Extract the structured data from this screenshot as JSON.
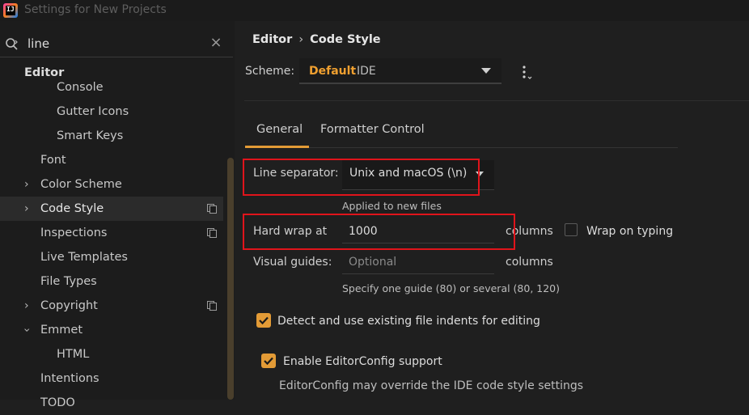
{
  "window": {
    "title": "Settings for New Projects"
  },
  "search": {
    "value": "line"
  },
  "sidebar": {
    "section": "Editor",
    "items": [
      {
        "label": "Console"
      },
      {
        "label": "Gutter Icons"
      },
      {
        "label": "Smart Keys"
      },
      {
        "label": "Font"
      },
      {
        "label": "Color Scheme"
      },
      {
        "label": "Code Style"
      },
      {
        "label": "Inspections"
      },
      {
        "label": "Live Templates"
      },
      {
        "label": "File Types"
      },
      {
        "label": "Copyright"
      },
      {
        "label": "Emmet"
      },
      {
        "label": "HTML"
      },
      {
        "label": "Intentions"
      },
      {
        "label": "TODO"
      }
    ]
  },
  "breadcrumb": {
    "parent": "Editor",
    "separator": "›",
    "current": "Code Style"
  },
  "scheme": {
    "label": "Scheme:",
    "name": "Default",
    "kind": "IDE"
  },
  "tabs": [
    {
      "label": "General"
    },
    {
      "label": "Formatter Control"
    }
  ],
  "general": {
    "line_separator": {
      "label": "Line separator:",
      "value": "Unix and macOS (\\n)",
      "hint": "Applied to new files"
    },
    "hard_wrap": {
      "label": "Hard wrap at",
      "value": "1000",
      "unit": "columns"
    },
    "wrap_on_typing": {
      "label": "Wrap on typing",
      "checked": false
    },
    "visual_guides": {
      "label": "Visual guides:",
      "placeholder": "Optional",
      "unit": "columns",
      "hint": "Specify one guide (80) or several (80, 120)"
    },
    "detect_indents": {
      "label": "Detect and use existing file indents for editing",
      "checked": true
    },
    "editorconfig": {
      "label": "Enable EditorConfig support",
      "checked": true,
      "hint": "EditorConfig may override the IDE code style settings"
    }
  },
  "colors": {
    "accent": "#e39b36",
    "highlight_box": "#e0141b",
    "background": "#1f1f1f"
  }
}
